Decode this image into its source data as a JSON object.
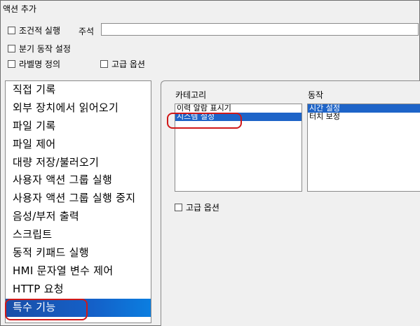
{
  "window": {
    "title": "액션 추가"
  },
  "top_options": {
    "conditional_exec_label": "조건적 실행",
    "comment_label": "주석",
    "comment_value": "",
    "branch_label": "분기 동작 설정",
    "label_name_label": "라벨명 정의",
    "advanced_label": "고급 옵션"
  },
  "action_list": {
    "items": [
      "직접 기록",
      "외부 장치에서 읽어오기",
      "파일 기록",
      "파일 제어",
      "대량 저장/불러오기",
      "사용자 액션 그룹 실행",
      "사용자 액션 그룹 실행 중지",
      "음성/부저 출력",
      "스크립트",
      "동적 키패드 실행",
      "HMI 문자열 변수 제어",
      "HTTP 요청",
      "특수 기능"
    ],
    "selected": "특수 기능"
  },
  "detail": {
    "category_label": "카테고리",
    "action_label": "동작",
    "categories": [
      "이력 알람 표시기",
      "시스템 설정"
    ],
    "selected_category": "시스템 설정",
    "actions": [
      "시간 설정",
      "터치 보정"
    ],
    "selected_action": "시간 설정",
    "advanced_label": "고급 옵션"
  }
}
